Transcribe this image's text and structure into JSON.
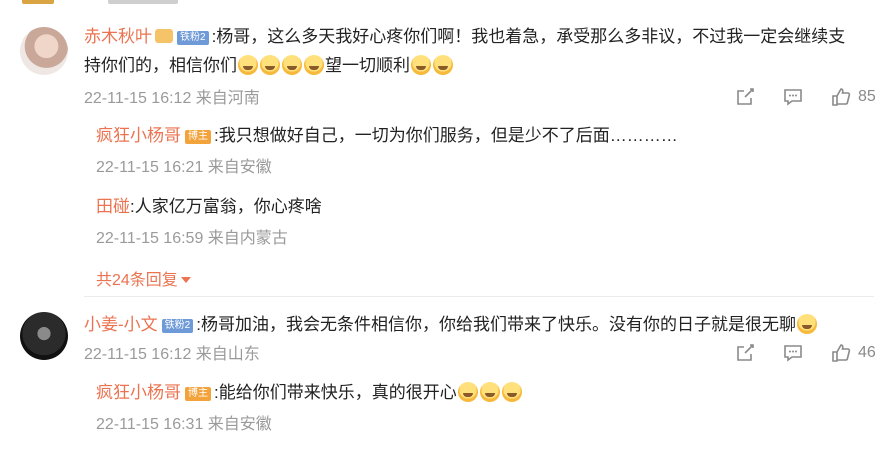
{
  "comments": [
    {
      "user": "赤木秋叶",
      "badge": "铁粉2",
      "text_line1": ":杨哥，这么多天我好心疼你们啊！我也着急，承受那么多非议，不过我一定会继续支",
      "text_line2_a": "持你们的，相信你们",
      "text_line2_b": "望一切顺利",
      "time": "22-11-15 16:12 来自河南",
      "likes": "85",
      "replies": [
        {
          "user": "疯狂小杨哥",
          "badge": "博主",
          "text": ":我只想做好自己，一切为你们服务，但是少不了后面…………",
          "time": "22-11-15 16:21 来自安徽"
        },
        {
          "user": "田碰",
          "text": ":人家亿万富翁，你心疼啥",
          "time": "22-11-15 16:59 来自内蒙古"
        }
      ],
      "more_replies": "共24条回复"
    },
    {
      "user": "小姜-小文",
      "badge": "铁粉2",
      "text": ":杨哥加油，我会无条件相信你，你给我们带来了快乐。没有你的日子就是很无聊",
      "time": "22-11-15 16:12 来自山东",
      "likes": "46",
      "replies": [
        {
          "user": "疯狂小杨哥",
          "badge": "博主",
          "text": ":能给你们带来快乐，真的很开心",
          "time": "22-11-15 16:31 来自安徽"
        }
      ]
    }
  ],
  "icons": [
    "share-icon",
    "comment-icon",
    "like-icon",
    "emoji-icon"
  ],
  "colors": {
    "username": "#eb7350",
    "meta": "#9a9a9a",
    "fan_badge": "#6f9ad8",
    "host_badge": "#f2a33b"
  }
}
